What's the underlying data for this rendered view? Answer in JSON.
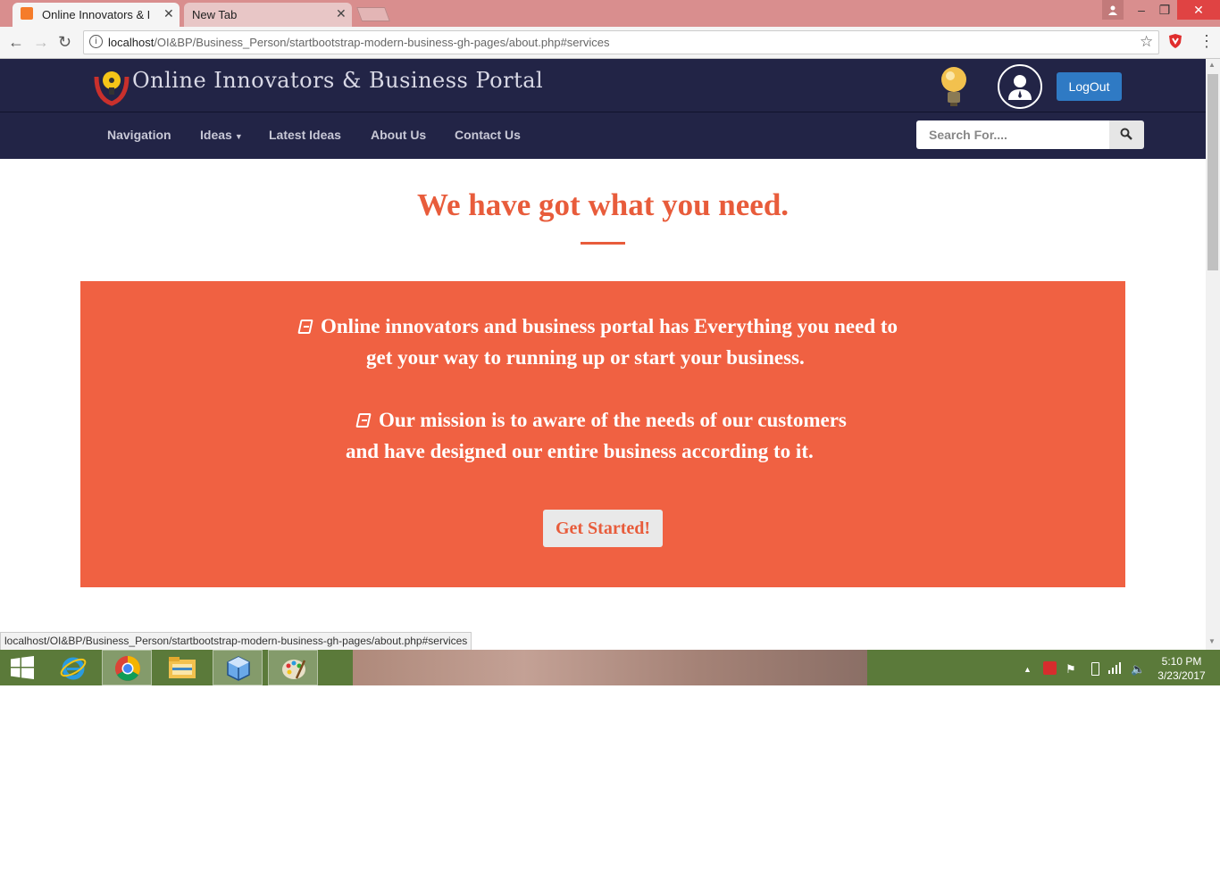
{
  "browser": {
    "tabs": [
      {
        "title": "Online Innovators & Busi",
        "active": true
      },
      {
        "title": "New Tab",
        "active": false
      }
    ],
    "url_host": "localhost",
    "url_path": "/OI&BP/Business_Person/startbootstrap-modern-business-gh-pages/about.php#services",
    "status_url": "localhost/OI&BP/Business_Person/startbootstrap-modern-business-gh-pages/about.php#services"
  },
  "site": {
    "brand": "Online Innovators & Business Portal",
    "logout_label": "LogOut",
    "nav": [
      "Navigation",
      "Ideas",
      "Latest Ideas",
      "About Us",
      "Contact Us"
    ],
    "search_placeholder": "Search For...."
  },
  "content": {
    "heading": "We have got what you need.",
    "para1_line1": "Online innovators and business portal has Everything you need to",
    "para1_line2": "get your way to running up or start your business.",
    "para2_line1": "Our mission is to aware of the needs of our customers",
    "para2_line2": "and have designed our entire business according to it.",
    "cta": "Get Started!"
  },
  "taskbar": {
    "time": "5:10 PM",
    "date": "3/23/2017"
  },
  "colors": {
    "accent": "#f06142",
    "header_bg": "#222446",
    "logout_blue": "#2f7ac4",
    "taskbar": "#5b7a3a"
  }
}
